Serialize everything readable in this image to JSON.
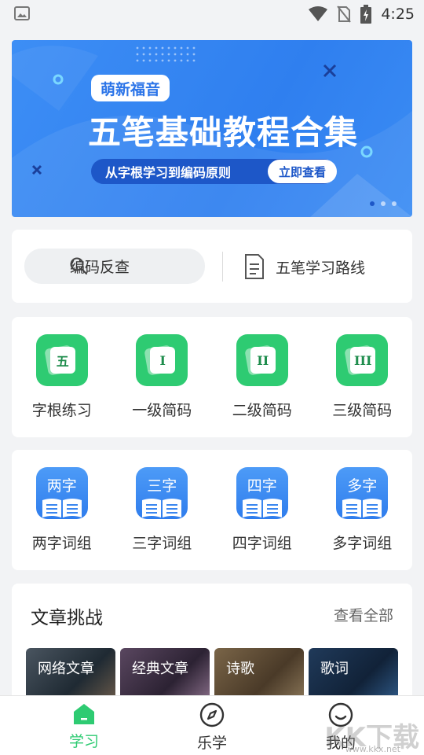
{
  "status_bar": {
    "time": "4:25"
  },
  "banner": {
    "pill": "萌新福音",
    "title": "五笔基础教程合集",
    "subtitle": "从字根学习到编码原则",
    "button": "立即查看",
    "accent": "#2f7fef"
  },
  "search": {
    "placeholder": "编码反查",
    "route_label": "五笔学习路线"
  },
  "jianma": [
    {
      "glyph": "五",
      "label": "字根练习"
    },
    {
      "glyph": "I",
      "label": "一级简码"
    },
    {
      "glyph": "II",
      "label": "二级简码"
    },
    {
      "glyph": "III",
      "label": "三级简码"
    }
  ],
  "cizu": [
    {
      "glyph": "两字",
      "label": "两字词组"
    },
    {
      "glyph": "三字",
      "label": "三字词组"
    },
    {
      "glyph": "四字",
      "label": "四字词组"
    },
    {
      "glyph": "多字",
      "label": "多字词组"
    }
  ],
  "articles": {
    "title": "文章挑战",
    "more": "查看全部",
    "items": [
      {
        "label": "网络文章"
      },
      {
        "label": "经典文章"
      },
      {
        "label": "诗歌"
      },
      {
        "label": "歌词"
      }
    ]
  },
  "bottom_nav": {
    "items": [
      {
        "label": "学习",
        "icon": "home-icon",
        "active": true
      },
      {
        "label": "乐学",
        "icon": "compass-icon",
        "active": false
      },
      {
        "label": "我的",
        "icon": "profile-icon",
        "active": false
      }
    ],
    "active_color": "#2ecb72"
  },
  "watermark": {
    "logo": "KK下载",
    "url": "www.kkx.net"
  }
}
